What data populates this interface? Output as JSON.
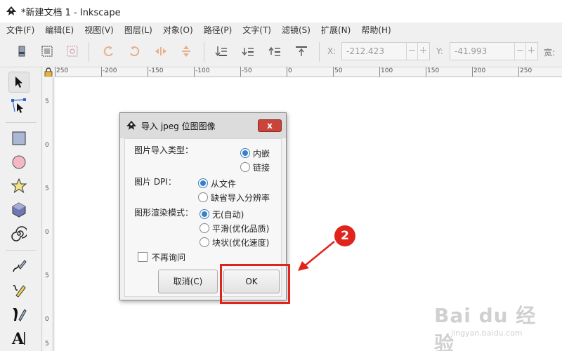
{
  "window": {
    "title": "*新建文档 1 - Inkscape"
  },
  "menu": [
    "文件(F)",
    "编辑(E)",
    "视图(V)",
    "图层(L)",
    "对象(O)",
    "路径(P)",
    "文字(T)",
    "滤镜(S)",
    "扩展(N)",
    "帮助(H)"
  ],
  "toolbar": {
    "x_label": "X:",
    "x_value": "-212.423",
    "y_label": "Y:",
    "y_value": "-41.993",
    "w_label": "宽:",
    "spin_minus": "−",
    "spin_plus": "+"
  },
  "ruler": {
    "top": [
      "250",
      "-200",
      "-150",
      "-100",
      "-50",
      "0",
      "50",
      "100",
      "150",
      "200",
      "250"
    ],
    "left": [
      "5",
      "0",
      "5",
      "0",
      "5",
      "0",
      "5"
    ]
  },
  "dialog": {
    "title": "导入 jpeg 位图图像",
    "close_label": "x",
    "import_type_label": "图片导入类型：",
    "import_type_options": [
      "内嵌",
      "链接"
    ],
    "dpi_label": "图片 DPI：",
    "dpi_options": [
      "从文件",
      "缺省导入分辨率"
    ],
    "render_label": "图形渲染模式：",
    "render_options": [
      "无(自动)",
      "平滑(优化品质)",
      "块状(优化速度)"
    ],
    "dont_ask_label": "不再询问",
    "cancel_label": "取消(C)",
    "ok_label": "OK"
  },
  "annotation": {
    "step_number": "2",
    "color": "#e0241c"
  },
  "watermark": {
    "main": "Bai du 经验",
    "sub": "jingyan.baidu.com"
  }
}
